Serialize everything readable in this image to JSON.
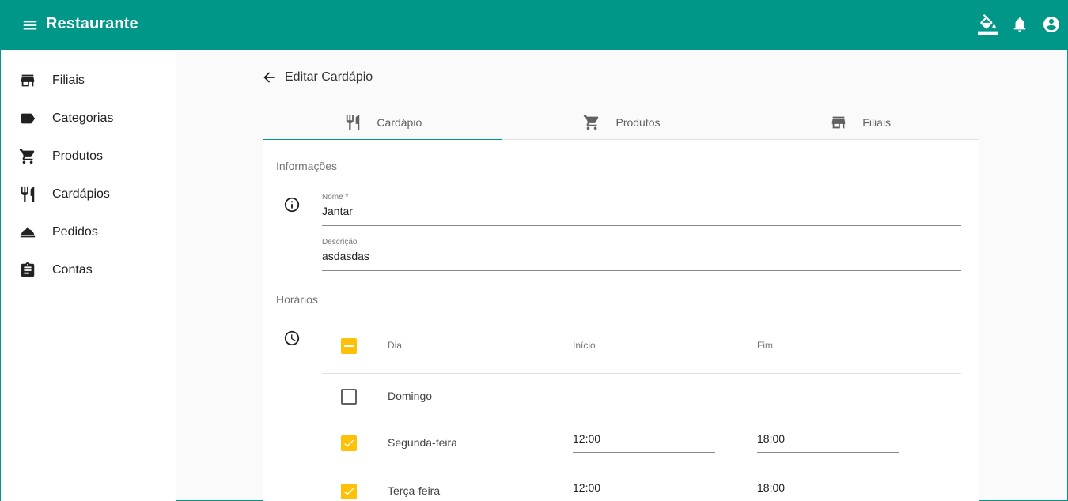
{
  "appbar": {
    "title": "Restaurante",
    "bg_color": "#009688",
    "icons": [
      "menu-icon",
      "format-color-fill-icon",
      "bell-icon",
      "account-circle-icon"
    ]
  },
  "sidebar": {
    "items": [
      {
        "label": "Filiais",
        "icon": "store-icon"
      },
      {
        "label": "Categorias",
        "icon": "label-icon"
      },
      {
        "label": "Produtos",
        "icon": "cart-icon"
      },
      {
        "label": "Cardápios",
        "icon": "restaurant-icon"
      },
      {
        "label": "Pedidos",
        "icon": "room-service-icon"
      },
      {
        "label": "Contas",
        "icon": "clipboard-icon"
      }
    ]
  },
  "header": {
    "title": "Editar Cardápio"
  },
  "tabs": [
    {
      "label": "Cardápio",
      "icon": "restaurant-icon",
      "active": true
    },
    {
      "label": "Produtos",
      "icon": "cart-icon",
      "active": false
    },
    {
      "label": "Filiais",
      "icon": "store-icon",
      "active": false
    }
  ],
  "info": {
    "section_title": "Informações",
    "name_label": "Nome *",
    "name_value": "Jantar",
    "desc_label": "Descrição",
    "desc_value": "asdasdas"
  },
  "schedule": {
    "section_title": "Horários",
    "columns": {
      "day": "Dia",
      "start": "Início",
      "end": "Fim"
    },
    "select_all_state": "indeterminate",
    "accent_color": "#ffc107",
    "rows": [
      {
        "day": "Domingo",
        "checked": false,
        "start": "",
        "end": ""
      },
      {
        "day": "Segunda-feira",
        "checked": true,
        "start": "12:00",
        "end": "18:00"
      },
      {
        "day": "Terça-feira",
        "checked": true,
        "start": "12:00",
        "end": "18:00"
      }
    ]
  }
}
